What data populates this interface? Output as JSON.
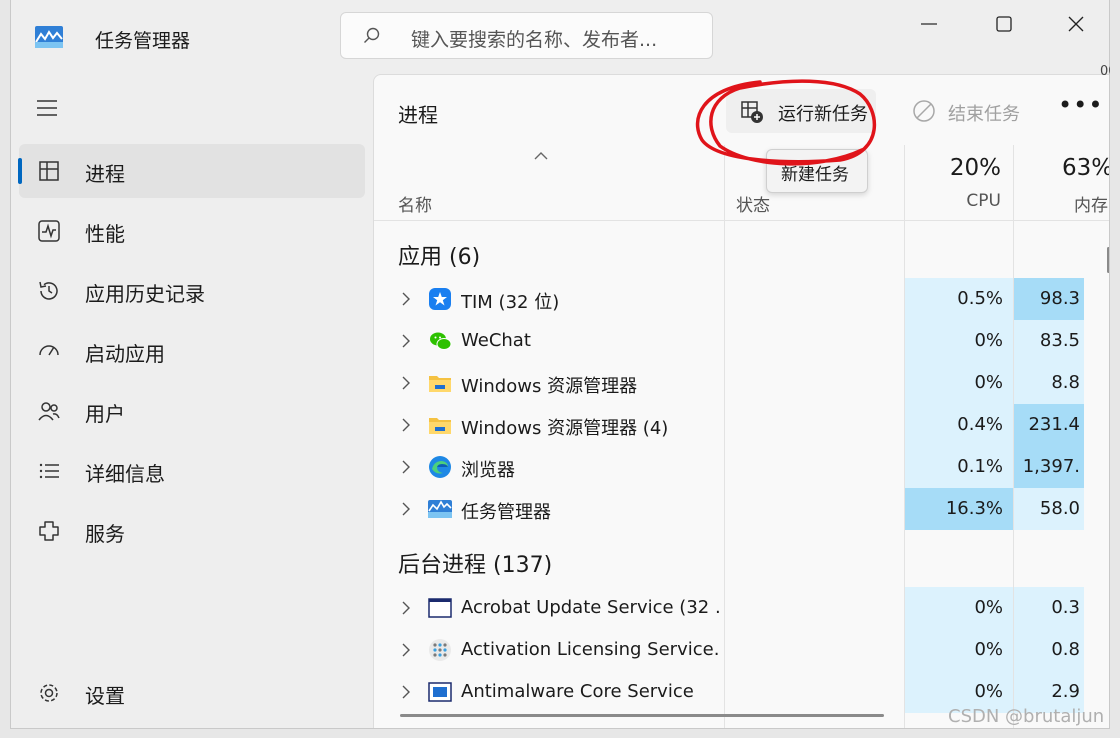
{
  "window": {
    "title": "任务管理器",
    "search_placeholder": "键入要搜索的名称、发布者...",
    "edge_fragment": "00"
  },
  "sidebar": {
    "items": [
      {
        "label": "进程",
        "icon": "processes-icon"
      },
      {
        "label": "性能",
        "icon": "performance-icon"
      },
      {
        "label": "应用历史记录",
        "icon": "history-icon"
      },
      {
        "label": "启动应用",
        "icon": "startup-icon"
      },
      {
        "label": "用户",
        "icon": "users-icon"
      },
      {
        "label": "详细信息",
        "icon": "details-icon"
      },
      {
        "label": "服务",
        "icon": "services-icon"
      }
    ],
    "settings_label": "设置"
  },
  "main": {
    "title": "进程",
    "run_task_label": "运行新任务",
    "end_task_label": "结束任务",
    "tooltip": "新建任务",
    "columns": {
      "name": "名称",
      "status": "状态",
      "cpu_pct": "20%",
      "cpu": "CPU",
      "mem_pct": "63%",
      "mem": "内存"
    },
    "groups": [
      {
        "title": "应用 (6)",
        "rows": [
          {
            "name": "TIM (32 位)",
            "icon": "tim-icon",
            "cpu": "0.5%",
            "mem": "98.3"
          },
          {
            "name": "WeChat",
            "icon": "wechat-icon",
            "cpu": "0%",
            "mem": "83.5"
          },
          {
            "name": "Windows 资源管理器",
            "icon": "folder-icon",
            "cpu": "0%",
            "mem": "8.8"
          },
          {
            "name": "Windows 资源管理器 (4)",
            "icon": "folder-icon",
            "cpu": "0.4%",
            "mem": "231.4"
          },
          {
            "name": "浏览器",
            "icon": "edge-icon",
            "cpu": "0.1%",
            "mem": "1,397."
          },
          {
            "name": "任务管理器",
            "icon": "task-manager-icon",
            "cpu": "16.3%",
            "mem": "58.0"
          }
        ]
      },
      {
        "title": "后台进程 (137)",
        "rows": [
          {
            "name": "Acrobat Update Service (32 ...",
            "icon": "window-icon",
            "cpu": "0%",
            "mem": "0.3"
          },
          {
            "name": "Activation Licensing Service...",
            "icon": "dots-icon",
            "cpu": "0%",
            "mem": "0.8"
          },
          {
            "name": "Antimalware Core Service",
            "icon": "service-icon",
            "cpu": "0%",
            "mem": "2.9"
          }
        ]
      }
    ]
  },
  "watermark": "CSDN @brutaljun",
  "colors": {
    "accent": "#0067c0",
    "heat_low": "#dcf2fd",
    "heat_mid": "#c6e9fb",
    "heat_high": "#a6dcf7",
    "annotation": "#e0141a"
  }
}
